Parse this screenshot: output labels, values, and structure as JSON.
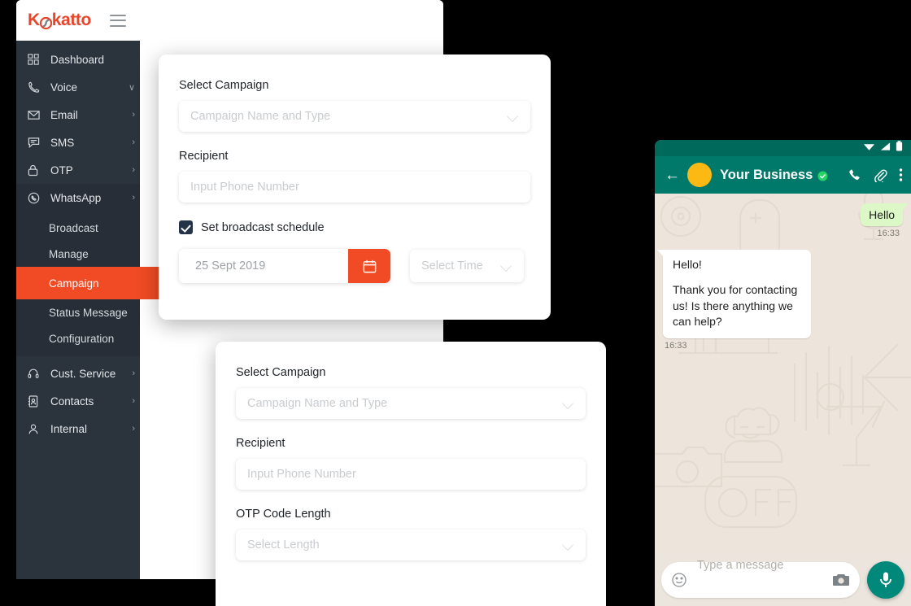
{
  "app": {
    "logo_text_before": "K",
    "logo_text_after": "katto",
    "menu_icon": "hamburger-icon"
  },
  "sidebar": {
    "items": [
      {
        "label": "Dashboard",
        "icon": "grid-icon",
        "caret": ""
      },
      {
        "label": "Voice",
        "icon": "phone-icon",
        "caret": "∨"
      },
      {
        "label": "Email",
        "icon": "envelope-icon",
        "caret": "›"
      },
      {
        "label": "SMS",
        "icon": "chat-icon",
        "caret": "›"
      },
      {
        "label": "OTP",
        "icon": "lock-icon",
        "caret": "›"
      },
      {
        "label": "WhatsApp",
        "icon": "whatsapp-icon",
        "caret": "›"
      }
    ],
    "submenu": [
      {
        "label": "Broadcast",
        "active": false
      },
      {
        "label": "Manage",
        "active": false
      },
      {
        "label": "Campaign",
        "active": true
      },
      {
        "label": "Status Message",
        "active": false
      },
      {
        "label": "Configuration",
        "active": false
      }
    ],
    "items_bottom": [
      {
        "label": "Cust. Service",
        "icon": "headset-icon",
        "caret": "›"
      },
      {
        "label": "Contacts",
        "icon": "contact-book-icon",
        "caret": "›"
      },
      {
        "label": "Internal",
        "icon": "user-icon",
        "caret": "›"
      }
    ],
    "active_color": "#F04B24",
    "background": "#2B333D"
  },
  "panel_broadcast": {
    "campaign_label": "Select Campaign",
    "campaign_placeholder": "Campaign Name and Type",
    "recipient_label": "Recipient",
    "recipient_placeholder": "Input Phone Number",
    "schedule_checkbox_label": "Set broadcast schedule",
    "schedule_checked": true,
    "date_value": "25 Sept 2019",
    "calendar_icon": "calendar-icon",
    "time_placeholder": "Select Time"
  },
  "panel_otp": {
    "campaign_label": "Select Campaign",
    "campaign_placeholder": "Campaign Name and Type",
    "recipient_label": "Recipient",
    "recipient_placeholder": "Input Phone Number",
    "otp_length_label": "OTP Code Length",
    "otp_length_placeholder": "Select Length"
  },
  "whatsapp": {
    "contact_name": "Your Business",
    "verified": true,
    "header_color": "#00796B",
    "back_icon": "arrow-left-icon",
    "call_icon": "phone-icon",
    "attach_icon": "paperclip-icon",
    "more_icon": "more-vertical-icon",
    "status_icons": [
      "wifi-icon",
      "signal-icon",
      "battery-icon"
    ],
    "messages": [
      {
        "direction": "out",
        "text": "Hello",
        "time": "16:33"
      },
      {
        "direction": "in",
        "line1": "Hello!",
        "line2": "Thank you for contacting us! Is there anything we can help?",
        "time": "16:33"
      }
    ],
    "input_placeholder": "Type a message",
    "emoji_icon": "smiley-icon",
    "camera_icon": "camera-icon",
    "mic_icon": "microphone-icon"
  }
}
